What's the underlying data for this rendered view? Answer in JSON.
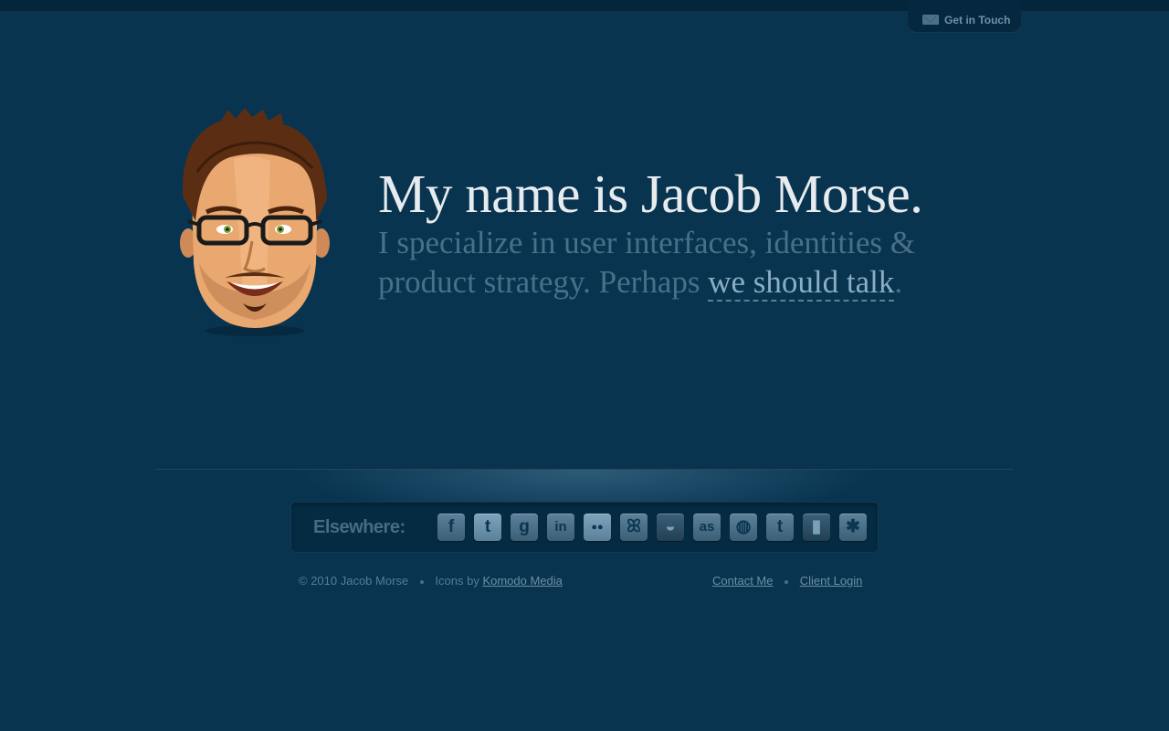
{
  "header": {
    "contact_tab_label": "Get in Touch",
    "contact_tab_icon": "mail-icon"
  },
  "hero": {
    "headline": "My name is Jacob Morse.",
    "sub_text": "I specialize in user interfaces, identities & product strategy. Perhaps ",
    "sub_link": "we should talk",
    "sub_end": ".",
    "avatar_icon": "avatar-illustration"
  },
  "elsewhere": {
    "title": "Elsewhere:",
    "icons": [
      {
        "name": "facebook-icon",
        "glyph": "f"
      },
      {
        "name": "twitter-icon",
        "glyph": "t"
      },
      {
        "name": "google-icon",
        "glyph": "g"
      },
      {
        "name": "linkedin-icon",
        "glyph": "in"
      },
      {
        "name": "flickr-icon",
        "glyph": "●●"
      },
      {
        "name": "delicious-icon",
        "glyph": "ꕤ"
      },
      {
        "name": "reader-icon",
        "glyph": "◒"
      },
      {
        "name": "lastfm-icon",
        "glyph": "as"
      },
      {
        "name": "dribbble-icon",
        "glyph": "◍"
      },
      {
        "name": "tumblr-icon",
        "glyph": "t"
      },
      {
        "name": "book-icon",
        "glyph": "▮"
      },
      {
        "name": "yelp-icon",
        "glyph": "✱"
      }
    ]
  },
  "footer": {
    "copyright": "© 2010 Jacob Morse",
    "icons_by": "Icons by",
    "icons_by_link": "Komodo Media",
    "contact": "Contact Me",
    "client_login": "Client Login"
  },
  "colors": {
    "background": "#083450",
    "headline": "#e7ebee",
    "subtext": "#4a7089",
    "link": "#8aaec4"
  }
}
